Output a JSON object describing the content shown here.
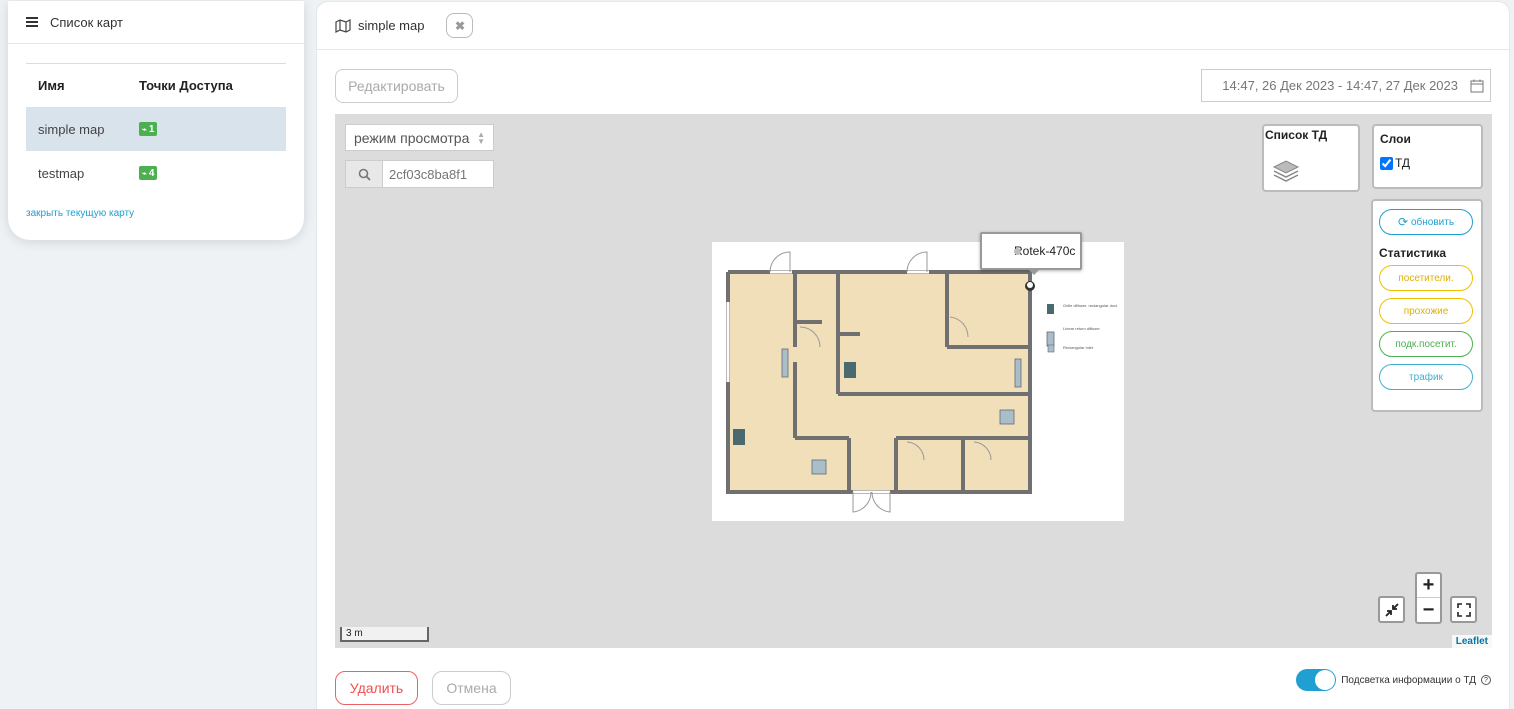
{
  "left_panel": {
    "title": "Список карт",
    "columns": [
      "Имя",
      "Точки Доступа"
    ],
    "maps": [
      {
        "name": "simple map",
        "ap_count": "1",
        "active": true
      },
      {
        "name": "testmap",
        "ap_count": "4",
        "active": false
      }
    ],
    "close_link": "закрыть текущую карту"
  },
  "tab": {
    "title": "simple map"
  },
  "toolbar": {
    "edit_label": "Редактировать",
    "date_range": "14:47, 26 Дек 2023 - 14:47, 27 Дек 2023"
  },
  "map": {
    "mode": "режим просмотра",
    "search_placeholder": "2cf03c8ba8f1",
    "ap_list_title": "Список ТД",
    "layers_title": "Слои",
    "layer_ap": "ТД",
    "refresh_label": "обновить",
    "stats_title": "Статистика",
    "stats": {
      "visitors": "посетители.",
      "passersby": "прохожие",
      "connected": "подк.посетит.",
      "traffic": "трафик"
    },
    "tooltip_ap": "Rotek-470c",
    "scale": "3 m",
    "attribution": "Leaflet",
    "legend": [
      "Grille diffuser, rectangular duct",
      "Linear return diffuser",
      "Rectangular inlet"
    ]
  },
  "footer": {
    "delete_label": "Удалить",
    "cancel_label": "Отмена",
    "highlight_label": "Подсветка информации о ТД",
    "highlight_on": true
  },
  "colors": {
    "accent": "#20a0d0",
    "danger": "#f05050",
    "success": "#4caf50",
    "floor": "#f1dfba"
  }
}
